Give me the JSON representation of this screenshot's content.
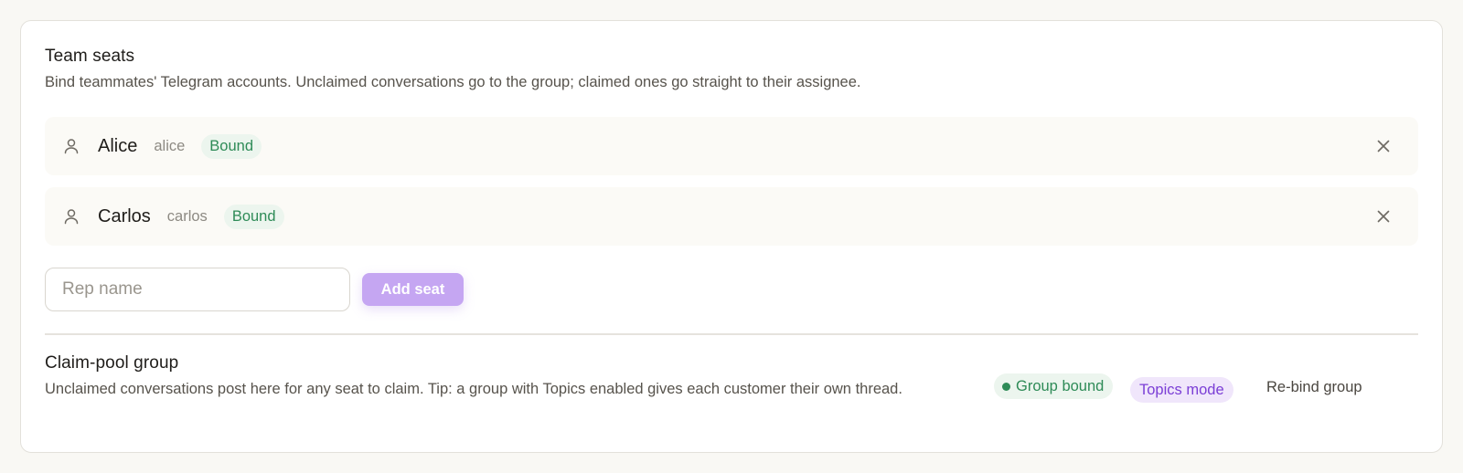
{
  "team_seats": {
    "title": "Team seats",
    "description": "Bind teammates' Telegram accounts. Unclaimed conversations go to the group; claimed ones go straight to their assignee.",
    "seats": [
      {
        "name": "Alice",
        "handle": "alice",
        "status": "Bound",
        "icon": "person-icon",
        "remove_icon": "close-icon"
      },
      {
        "name": "Carlos",
        "handle": "carlos",
        "status": "Bound",
        "icon": "person-icon",
        "remove_icon": "close-icon"
      }
    ],
    "rep_input": {
      "value": "",
      "placeholder": "Rep name"
    },
    "add_button_label": "Add seat"
  },
  "claim_pool": {
    "title": "Claim-pool group",
    "description": "Unclaimed conversations post here for any seat to claim. Tip: a group with Topics enabled gives each customer their own thread.",
    "group_status": "Group bound",
    "mode_badge": "Topics mode",
    "rebind_label": "Re-bind group"
  },
  "colors": {
    "accent_purple": "#c5a6f2",
    "bound_green": "#2e8b57",
    "topics_purple": "#7b3ed6"
  }
}
